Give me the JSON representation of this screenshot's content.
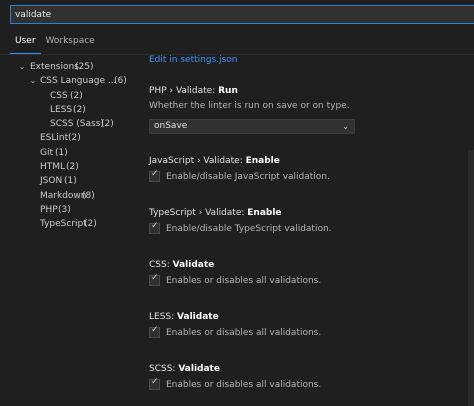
{
  "search": {
    "value": "validate"
  },
  "tabs": [
    {
      "label": "User"
    },
    {
      "label": "Workspace"
    }
  ],
  "tree": [
    {
      "label": "Extensions",
      "count": "(25)",
      "chevron": "⌄"
    },
    {
      "label": "CSS Language ...",
      "count": "(6)",
      "chevron": "⌄"
    },
    {
      "label": "CSS",
      "count": "(2)"
    },
    {
      "label": "LESS",
      "count": "(2)"
    },
    {
      "label": "SCSS (Sass)",
      "count": "(2)"
    },
    {
      "label": "ESLint",
      "count": "(2)"
    },
    {
      "label": "Git",
      "count": "(1)"
    },
    {
      "label": "HTML",
      "count": "(2)"
    },
    {
      "label": "JSON",
      "count": "(1)"
    },
    {
      "label": "Markdown",
      "count": "(8)"
    },
    {
      "label": "PHP",
      "count": "(3)"
    },
    {
      "label": "TypeScript",
      "count": "(2)"
    }
  ],
  "content": {
    "top_link": "Edit in settings.json",
    "php": {
      "prefix": "PHP › Validate: ",
      "name": "Run",
      "desc": "Whether the linter is run on save or on type.",
      "select_value": "onSave"
    },
    "checks": [
      {
        "prefix": "JavaScript › Validate: ",
        "name": "Enable",
        "label": "Enable/disable JavaScript validation."
      },
      {
        "prefix": "TypeScript › Validate: ",
        "name": "Enable",
        "label": "Enable/disable TypeScript validation."
      },
      {
        "prefix": "CSS: ",
        "name": "Validate",
        "label": "Enables or disables all validations."
      },
      {
        "prefix": "LESS: ",
        "name": "Validate",
        "label": "Enables or disables all validations."
      },
      {
        "prefix": "SCSS: ",
        "name": "Validate",
        "label": "Enables or disables all validations."
      }
    ],
    "tick_glyph": "✓"
  }
}
